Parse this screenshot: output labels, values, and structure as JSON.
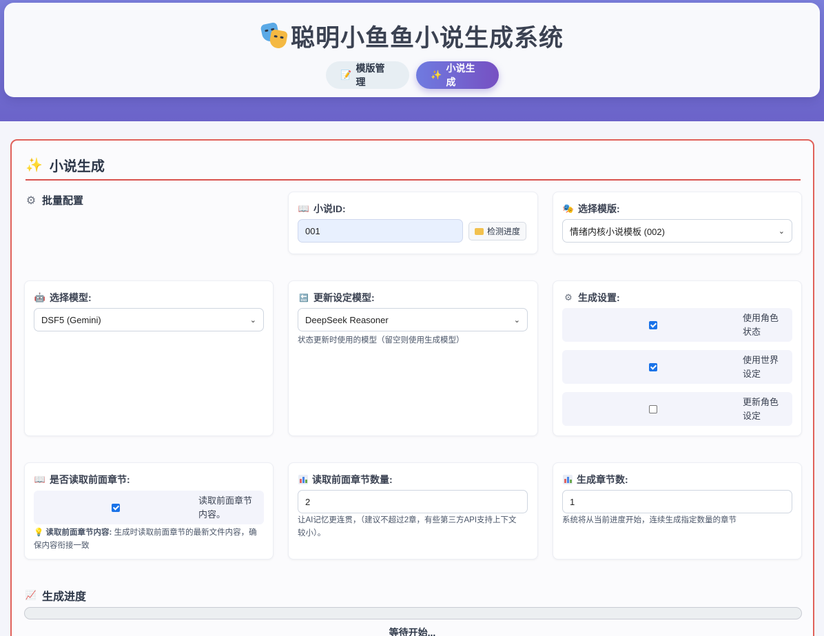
{
  "header": {
    "title": "聪明小鱼鱼小说生成系统",
    "nav": [
      {
        "label": "模版管理",
        "icon": "memo-icon",
        "active": false
      },
      {
        "label": "小说生成",
        "icon": "sparkles-icon",
        "active": true
      }
    ]
  },
  "section": {
    "title": "小说生成",
    "batch_label": "批量配置"
  },
  "novel_id": {
    "label": "小说ID:",
    "value": "001",
    "detect_button": "检测进度"
  },
  "template": {
    "label": "选择模版:",
    "selected": "情绪内核小说模板 (002)"
  },
  "model": {
    "label": "选择模型:",
    "selected": "DSF5 (Gemini)"
  },
  "update_model": {
    "label": "更新设定模型:",
    "selected": "DeepSeek Reasoner",
    "hint": "状态更新时使用的模型（留空则使用生成模型）"
  },
  "gen_settings": {
    "label": "生成设置:",
    "options": [
      {
        "text": "使用角色状态",
        "line1": "使用角色",
        "line2": "状态",
        "checked": true
      },
      {
        "text": "使用世界设定",
        "line1": "使用世界",
        "line2": "设定",
        "checked": true
      },
      {
        "text": "更新角色设定",
        "line1": "更新角色",
        "line2": "设定",
        "checked": false
      }
    ]
  },
  "read_prev": {
    "label": "是否读取前面章节:",
    "checkbox_line1": "读取前面章节",
    "checkbox_line2": "内容。",
    "checked": true,
    "hint_bold": "读取前面章节内容:",
    "hint_text": "生成时读取前面章节的最新文件内容，确",
    "hint_text2": "保内容衔接一致"
  },
  "read_count": {
    "label": "读取前面章节数量:",
    "value": "2",
    "hint1": "让AI记忆更连贯，（建议不超过2章，有些第三方API支持上下文",
    "hint2": "较小）。"
  },
  "chapter_count": {
    "label": "生成章节数:",
    "value": "1",
    "hint": "系统将从当前进度开始，连续生成指定数量的章节"
  },
  "progress": {
    "label": "生成进度",
    "percent": 0,
    "status": "等待开始..."
  }
}
